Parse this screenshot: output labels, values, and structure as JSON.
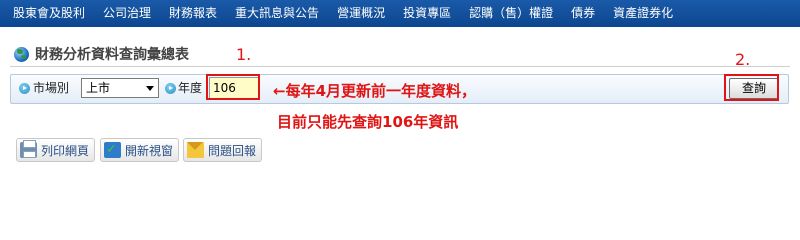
{
  "nav": {
    "items": [
      "股東會及股利",
      "公司治理",
      "財務報表",
      "重大訊息與公告",
      "營運概況",
      "投資專區",
      "認購（售）權證",
      "債券",
      "資產證券化"
    ]
  },
  "section": {
    "title": "財務分析資料查詢彙總表"
  },
  "query": {
    "market_label": "市場別",
    "market_value": "上市",
    "year_label": "年度",
    "year_value": "106",
    "submit_label": "查詢"
  },
  "annotations": {
    "marker_1": "1.",
    "marker_2": "2.",
    "note_line1": "每年4月更新前一年度資料，",
    "note_arrow": "←",
    "note_line2": "目前只能先查詢106年資訊",
    "highlight_color": "#e01414"
  },
  "actions": {
    "print_label": "列印網頁",
    "new_window_label": "開新視窗",
    "report_label": "問題回報"
  }
}
